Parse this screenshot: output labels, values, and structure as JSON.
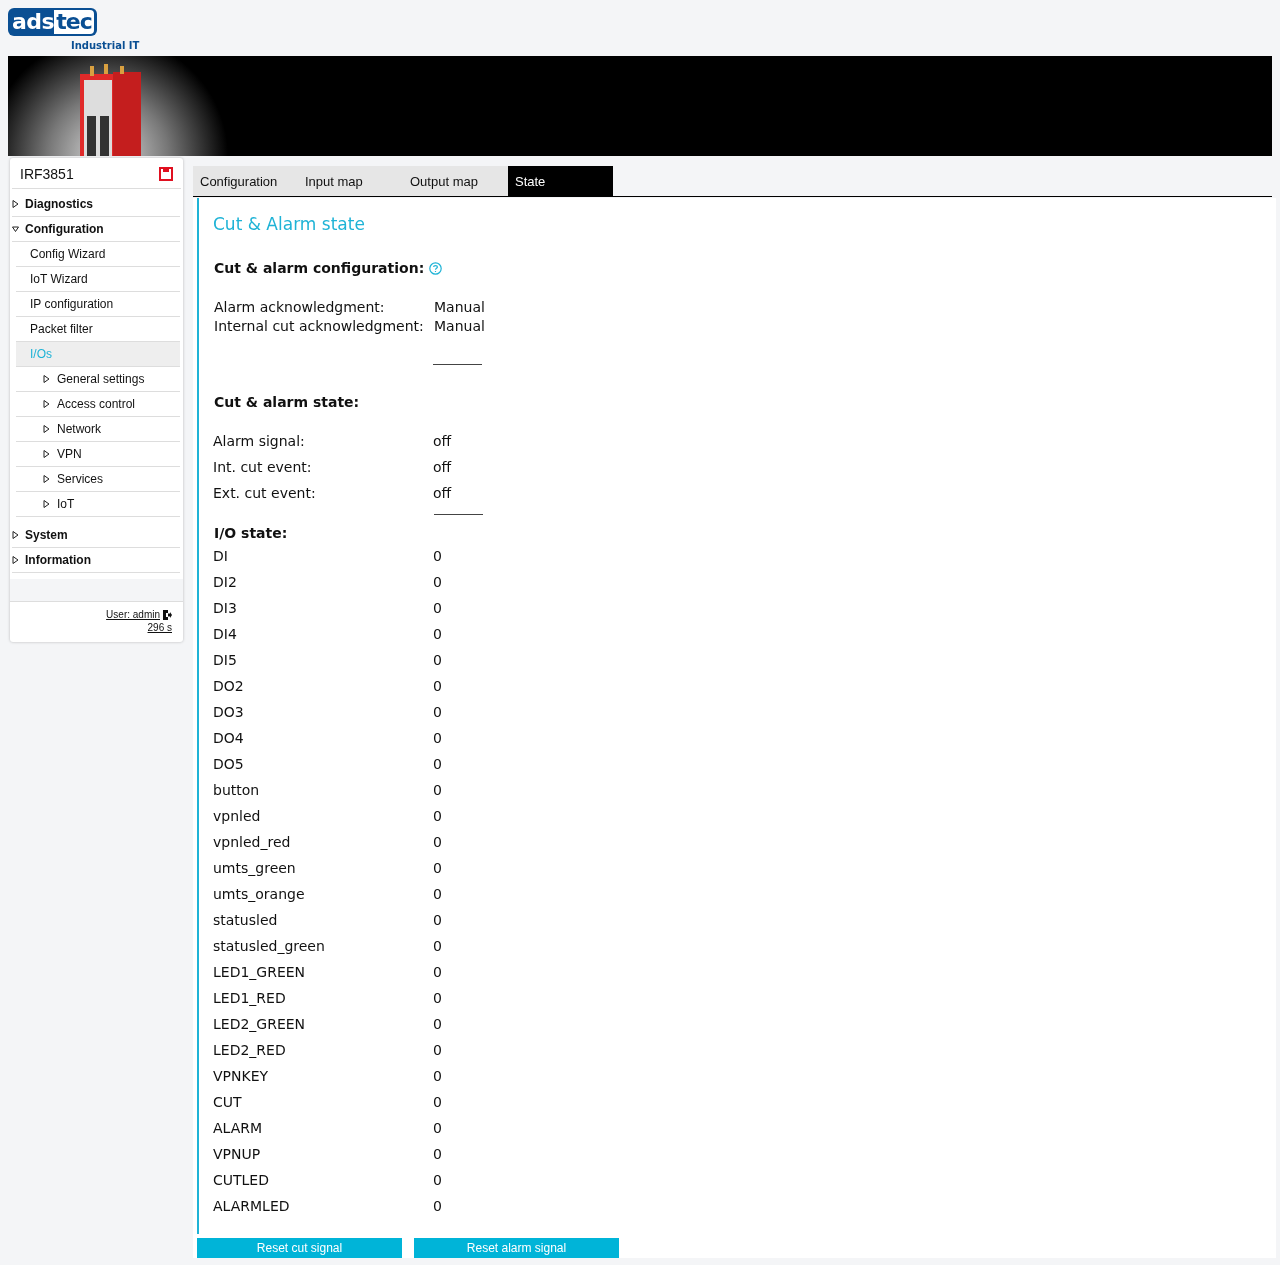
{
  "logo": {
    "left": "ads",
    "right": "tec",
    "tagline": "Industrial IT"
  },
  "banner": {
    "kind": "picture"
  },
  "sidebar": {
    "device": "IRF3851",
    "items": [
      {
        "label": "Diagnostics",
        "expanded": false,
        "selected": false
      },
      {
        "label": "Configuration",
        "expanded": true,
        "selected": false,
        "children": [
          {
            "label": "Config Wizard",
            "selected": false
          },
          {
            "label": "IoT Wizard",
            "selected": false
          },
          {
            "label": "IP configuration",
            "selected": false
          },
          {
            "label": "Packet filter",
            "selected": false
          },
          {
            "label": "I/Os",
            "selected": true,
            "children": [
              {
                "label": "General settings",
                "expanded": false,
                "selected": false
              },
              {
                "label": "Access control",
                "expanded": false,
                "selected": false
              },
              {
                "label": "Network",
                "expanded": false,
                "selected": false
              },
              {
                "label": "VPN",
                "expanded": false,
                "selected": false
              },
              {
                "label": "Services",
                "expanded": false,
                "selected": false
              },
              {
                "label": "IoT",
                "expanded": false,
                "selected": false
              }
            ]
          }
        ]
      },
      {
        "label": "System",
        "expanded": false,
        "selected": false
      },
      {
        "label": "Information",
        "expanded": false,
        "selected": false
      }
    ],
    "user": "User: admin",
    "timer": "296 s"
  },
  "tabs": [
    {
      "label": "Configuration",
      "selected": false
    },
    {
      "label": "Input map",
      "selected": false
    },
    {
      "label": "Output map",
      "selected": false
    },
    {
      "label": "State",
      "selected": true
    }
  ],
  "title": "Cut & Alarm state",
  "config": {
    "heading": "Cut & alarm configuration:",
    "rows": [
      {
        "label": "Alarm acknowledgment:",
        "value": "Manual"
      },
      {
        "label": "Internal cut acknowledgment:",
        "value": "Manual"
      }
    ]
  },
  "state": {
    "heading": "Cut & alarm state:",
    "rows": [
      {
        "label": "Alarm signal:",
        "value": "off"
      },
      {
        "label": "Int. cut event:",
        "value": "off"
      },
      {
        "label": "Ext. cut event:",
        "value": "off"
      }
    ]
  },
  "io": {
    "heading": "I/O state:",
    "rows": [
      {
        "label": "DI",
        "value": "0"
      },
      {
        "label": "DI2",
        "value": "0"
      },
      {
        "label": "DI3",
        "value": "0"
      },
      {
        "label": "DI4",
        "value": "0"
      },
      {
        "label": "DI5",
        "value": "0"
      },
      {
        "label": "DO2",
        "value": "0"
      },
      {
        "label": "DO3",
        "value": "0"
      },
      {
        "label": "DO4",
        "value": "0"
      },
      {
        "label": "DO5",
        "value": "0"
      },
      {
        "label": "button",
        "value": "0"
      },
      {
        "label": "vpnled",
        "value": "0"
      },
      {
        "label": "vpnled_red",
        "value": "0"
      },
      {
        "label": "umts_green",
        "value": "0"
      },
      {
        "label": "umts_orange",
        "value": "0"
      },
      {
        "label": "statusled",
        "value": "0"
      },
      {
        "label": "statusled_green",
        "value": "0"
      },
      {
        "label": "LED1_GREEN",
        "value": "0"
      },
      {
        "label": "LED1_RED",
        "value": "0"
      },
      {
        "label": "LED2_GREEN",
        "value": "0"
      },
      {
        "label": "LED2_RED",
        "value": "0"
      },
      {
        "label": "VPNKEY",
        "value": "0"
      },
      {
        "label": "CUT",
        "value": "0"
      },
      {
        "label": "ALARM",
        "value": "0"
      },
      {
        "label": "VPNUP",
        "value": "0"
      },
      {
        "label": "CUTLED",
        "value": "0"
      },
      {
        "label": "ALARMLED",
        "value": "0"
      }
    ]
  },
  "buttons": [
    "Reset cut signal",
    "Reset alarm signal"
  ]
}
